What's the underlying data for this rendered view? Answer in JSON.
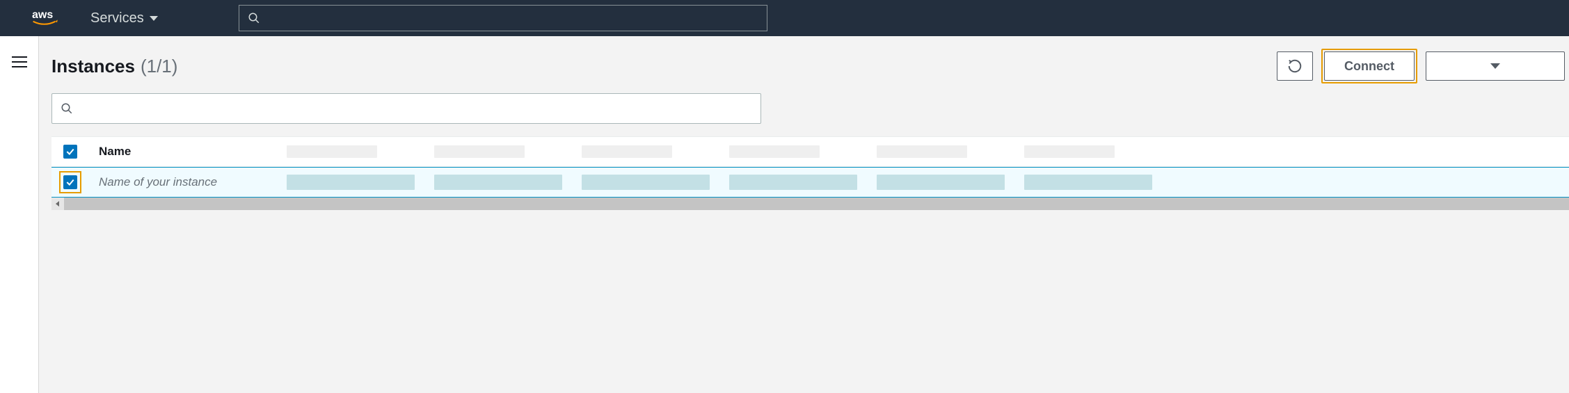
{
  "nav": {
    "services_label": "Services"
  },
  "page": {
    "title": "Instances",
    "count": "(1/1)"
  },
  "actions": {
    "connect_label": "Connect"
  },
  "table": {
    "columns": {
      "name": "Name"
    },
    "rows": [
      {
        "name": "Name of your instance",
        "selected": true
      }
    ]
  }
}
